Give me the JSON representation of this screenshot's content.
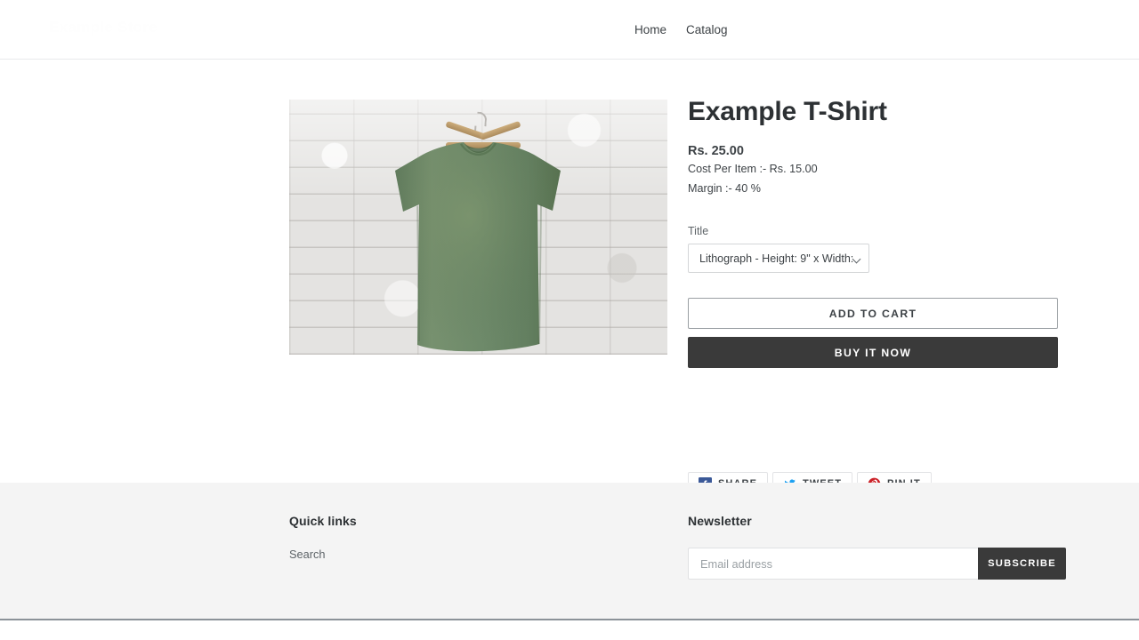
{
  "header": {
    "logo_text": "Example Store",
    "nav": [
      {
        "label": "Home"
      },
      {
        "label": "Catalog"
      }
    ]
  },
  "product": {
    "title": "Example T-Shirt",
    "price": "Rs. 25.00",
    "cost_per_item": "Cost Per Item :- Rs. 15.00",
    "margin": "Margin :- 40 %",
    "option_label": "Title",
    "selected_variant": "Lithograph - Height: 9\" x Width:",
    "add_to_cart_label": "ADD TO CART",
    "buy_now_label": "BUY IT NOW",
    "image_alt": "Green heather t-shirt on wooden hanger against white brick wall"
  },
  "share": [
    {
      "label": "SHARE",
      "icon": "facebook-icon",
      "color": "#3b5998"
    },
    {
      "label": "TWEET",
      "icon": "twitter-icon",
      "color": "#1da1f2"
    },
    {
      "label": "PIN IT",
      "icon": "pinterest-icon",
      "color": "#cb2027"
    }
  ],
  "footer": {
    "quick_links_title": "Quick links",
    "quick_links": [
      {
        "label": "Search"
      }
    ],
    "newsletter_title": "Newsletter",
    "email_placeholder": "Email address",
    "email_value": "",
    "subscribe_label": "SUBSCRIBE"
  },
  "colors": {
    "text": "#3d4246",
    "heading": "#2d3134",
    "dark_button": "#3a3a3a",
    "footer_bg": "#f4f4f4",
    "border": "#e8e9eb",
    "shirt_green": "#6f8a6b",
    "hanger_wood": "#c0a071"
  }
}
